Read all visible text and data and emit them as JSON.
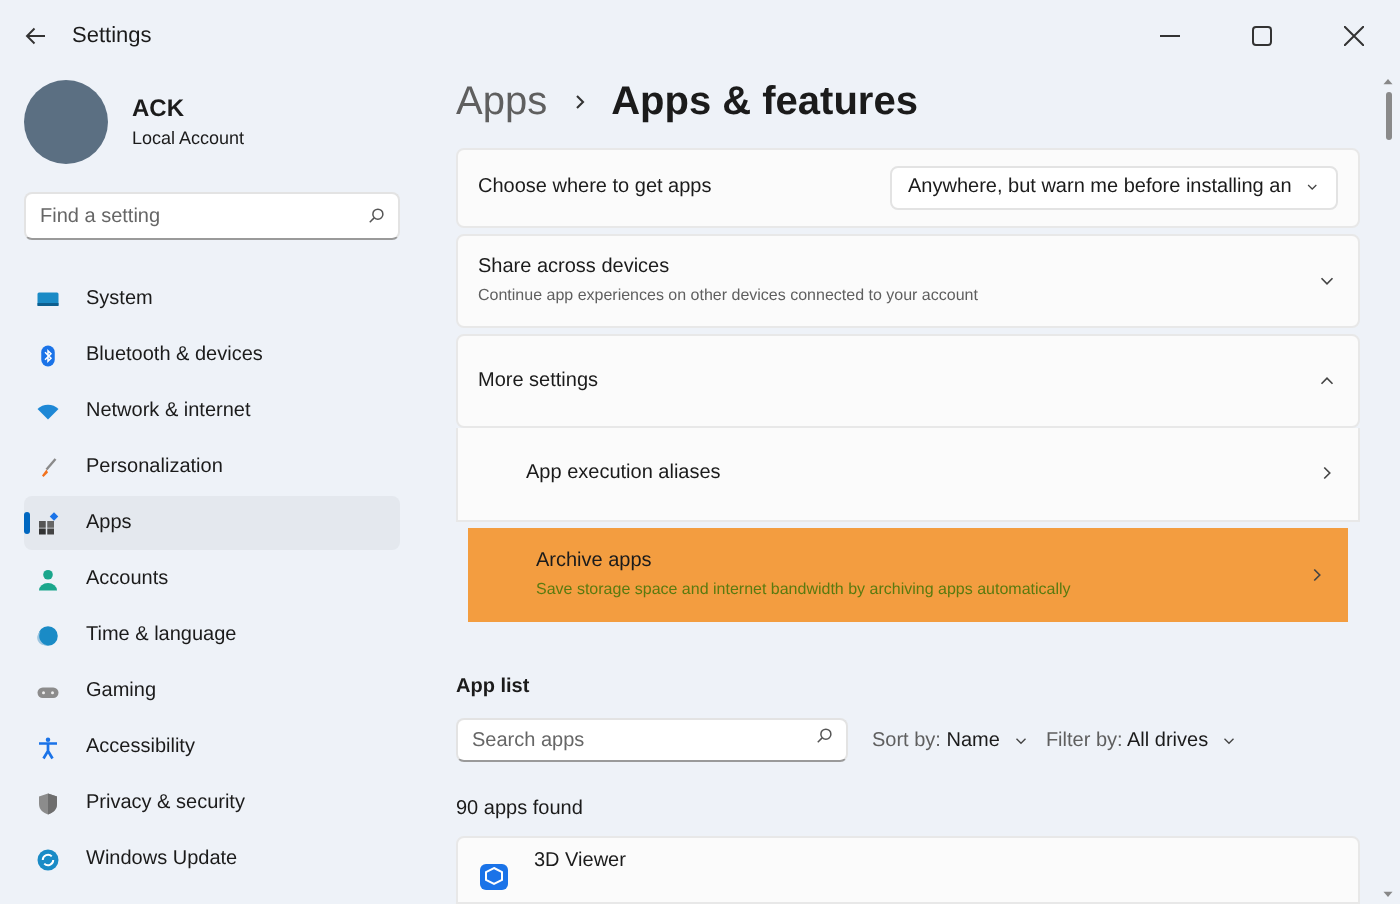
{
  "window": {
    "title": "Settings"
  },
  "account": {
    "name": "ACK",
    "type": "Local Account"
  },
  "search": {
    "placeholder": "Find a setting"
  },
  "nav": [
    {
      "label": "System",
      "selected": false
    },
    {
      "label": "Bluetooth & devices",
      "selected": false
    },
    {
      "label": "Network & internet",
      "selected": false
    },
    {
      "label": "Personalization",
      "selected": false
    },
    {
      "label": "Apps",
      "selected": true
    },
    {
      "label": "Accounts",
      "selected": false
    },
    {
      "label": "Time & language",
      "selected": false
    },
    {
      "label": "Gaming",
      "selected": false
    },
    {
      "label": "Accessibility",
      "selected": false
    },
    {
      "label": "Privacy & security",
      "selected": false
    },
    {
      "label": "Windows Update",
      "selected": false
    }
  ],
  "breadcrumb": [
    "Apps",
    "Apps & features"
  ],
  "settings": [
    {
      "kind": "dropdown",
      "title": "Choose where to get apps",
      "value": "Anywhere, but warn me before installing an"
    },
    {
      "kind": "expander",
      "title": "Share across devices",
      "description": "Continue app experiences on other devices connected to your account",
      "expanded": false
    },
    {
      "kind": "expander",
      "title": "More settings",
      "expanded": true,
      "children": [
        {
          "title": "App execution aliases",
          "highlighted": false
        },
        {
          "title": "Archive apps",
          "description": "Save storage space and internet bandwidth by archiving apps automatically",
          "highlighted": true
        }
      ]
    }
  ],
  "app_list": {
    "heading": "App list",
    "search_placeholder": "Search apps",
    "sort_label": "Sort by:",
    "sort_value": "Name",
    "filter_label": "Filter by:",
    "filter_value": "All drives",
    "count": "90 apps found",
    "apps": [
      {
        "name": "3D Viewer"
      }
    ]
  }
}
